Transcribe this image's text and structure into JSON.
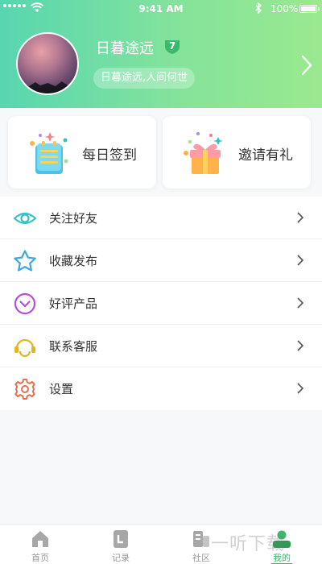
{
  "status_bar": {
    "time": "9:41 AM",
    "battery": "100%"
  },
  "profile": {
    "username": "日暮途远",
    "level": "7",
    "signature": "日暮途远,人间何世"
  },
  "cards": {
    "checkin_label": "每日签到",
    "invite_label": "邀请有礼"
  },
  "menu": {
    "items": [
      {
        "label": "关注好友",
        "icon": "eye-icon",
        "color": "#35c3c8"
      },
      {
        "label": "收藏发布",
        "icon": "star-icon",
        "color": "#3aa8e8"
      },
      {
        "label": "好评产品",
        "icon": "thumb-down-circle-icon",
        "color": "#b34fd9"
      },
      {
        "label": "联系客服",
        "icon": "headset-icon",
        "color": "#e3b421"
      },
      {
        "label": "设置",
        "icon": "gear-icon",
        "color": "#e4704b"
      }
    ]
  },
  "tabbar": {
    "tabs": [
      {
        "label": "首页",
        "icon": "home-icon"
      },
      {
        "label": "记录",
        "icon": "record-icon"
      },
      {
        "label": "社区",
        "icon": "community-icon"
      },
      {
        "label": "我的",
        "icon": "profile-icon"
      }
    ],
    "active": "我的"
  },
  "watermark": "一听下载",
  "colors": {
    "header_start": "#57d6b0",
    "header_end": "#9ae98f",
    "accent": "#3ab96a",
    "badge": "#3ab96a"
  }
}
